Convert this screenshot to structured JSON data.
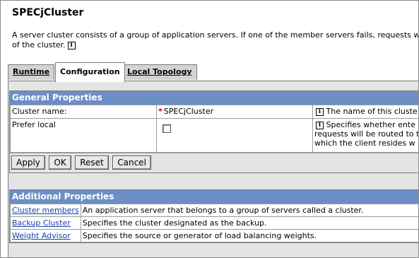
{
  "page": {
    "title": "SPECjCluster",
    "description_line1": "A server cluster consists of a group of application servers. If one of the member servers fails, requests will be routed",
    "description_line2": "of the cluster.",
    "info_glyph": "i"
  },
  "tabs": [
    {
      "label": "Runtime",
      "active": false
    },
    {
      "label": "Configuration",
      "active": true
    },
    {
      "label": "Local Topology",
      "active": false
    }
  ],
  "general": {
    "header": "General Properties",
    "rows": [
      {
        "label": "Cluster name:",
        "required": true,
        "value": "SPECjCluster",
        "description": [
          "The name of this cluste"
        ]
      },
      {
        "label": "Prefer local",
        "required": false,
        "checked": false,
        "description": [
          "Specifies whether ente",
          "requests will be routed to t",
          "which the client resides w"
        ]
      }
    ],
    "buttons": {
      "apply": "Apply",
      "ok": "OK",
      "reset": "Reset",
      "cancel": "Cancel"
    }
  },
  "additional": {
    "header": "Additional Properties",
    "rows": [
      {
        "link": "Cluster members",
        "description": "An application server that belongs to a group of servers called a cluster."
      },
      {
        "link": "Backup Cluster",
        "description": "Specifies the cluster designated as the backup."
      },
      {
        "link": "Weight Advisor",
        "description": "Specifies the source or generator of load balancing weights."
      }
    ]
  },
  "colors": {
    "panel_header": "#6c8ec6",
    "link": "#1a3fa8",
    "required": "#cc0000",
    "tab_bg": "#d3d3d3"
  }
}
